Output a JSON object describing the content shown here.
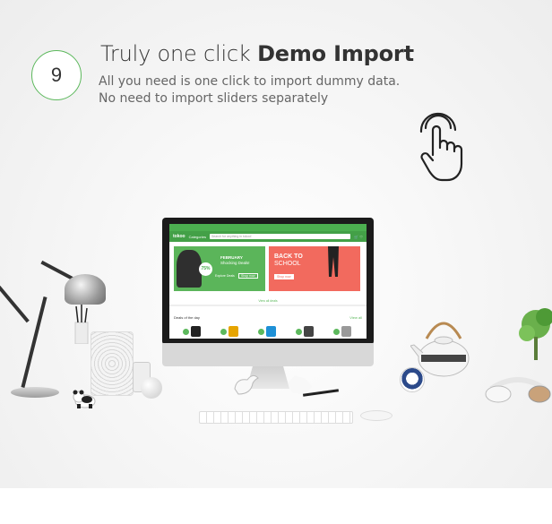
{
  "feature": {
    "number": "9",
    "title_light": "Truly one click",
    "title_bold": "Demo Import",
    "line1": "All you need is one click to import dummy data.",
    "line2": "No need to  import sliders separately",
    "accent_color": "#5cb85c"
  },
  "screen": {
    "logo": "tokoo",
    "categories": "Categories",
    "search_placeholder": "Search for anything in tokoo!",
    "banner_left": {
      "badge": "75%",
      "month": "FEBRUARY",
      "desc": "Shocking Deals!",
      "cta": "Explore Deals",
      "cta2": "Shop now"
    },
    "banner_right": {
      "title1": "BACK TO",
      "title2": "SCHOOL",
      "cta": "Shop now"
    },
    "view_all": "View all deals",
    "deals_heading": "Deals of the day",
    "deals_link": "View all"
  },
  "icons": [
    "hand-pointer-icon"
  ]
}
